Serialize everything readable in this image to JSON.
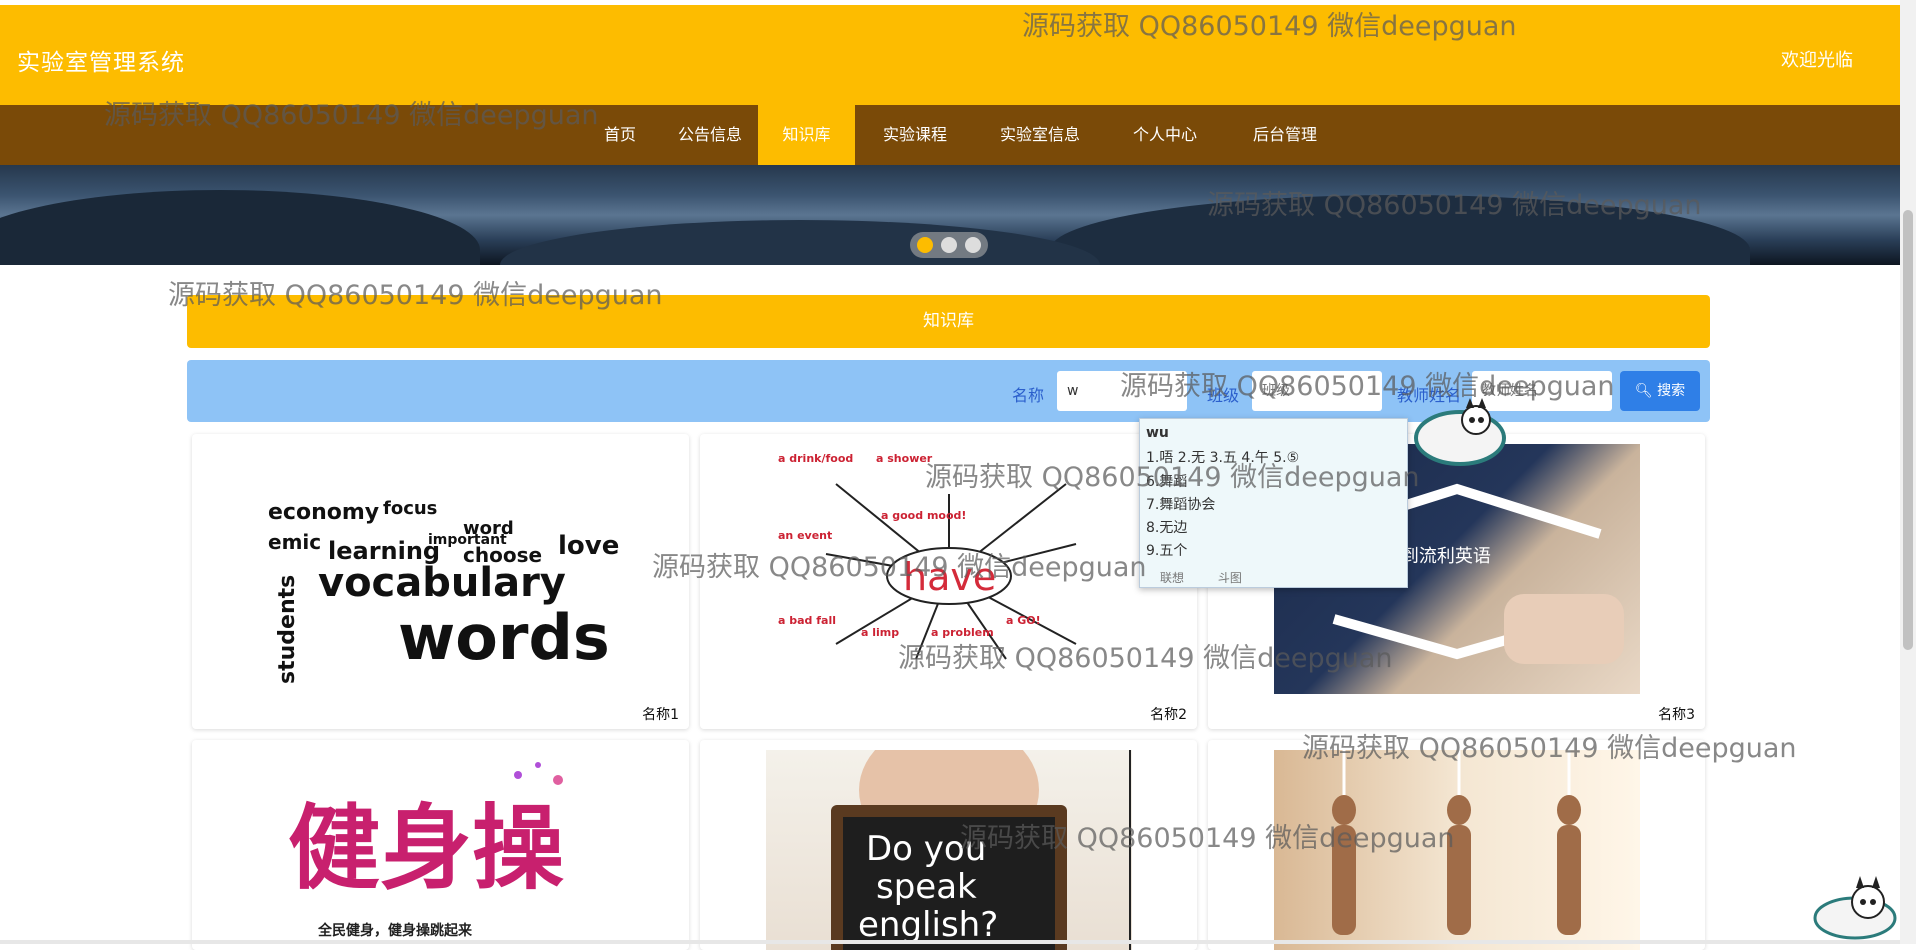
{
  "header": {
    "title": "实验室管理系统",
    "welcome": "欢迎光临"
  },
  "nav": {
    "items": [
      "首页",
      "公告信息",
      "知识库",
      "实验课程",
      "实验室信息",
      "个人中心",
      "后台管理"
    ],
    "active": "知识库"
  },
  "section": {
    "title": "知识库"
  },
  "search": {
    "name_label": "名称",
    "name_value": "w",
    "class_label": "班级",
    "class_placeholder": "班级",
    "teacher_label": "教师姓名",
    "teacher_placeholder": "教师姓名",
    "button_label": "搜索"
  },
  "cards": [
    {
      "caption": "名称1",
      "image_text": "vocabulary words"
    },
    {
      "caption": "名称2",
      "image_text": "have"
    },
    {
      "caption": "名称3",
      "image_text": "ABC到流利英语"
    },
    {
      "caption": "",
      "image_text": "健身操"
    },
    {
      "caption": "",
      "image_text": "Do you speak english?"
    },
    {
      "caption": "",
      "image_text": ""
    }
  ],
  "ime": {
    "composition": "wu",
    "candidates_row1": "1.唔  2.无  3.五  4.午  5.⑤",
    "candidates": [
      "6.舞蹈",
      "7.舞蹈协会",
      "8.无边",
      "9.五个"
    ],
    "footer": [
      "联想",
      "斗图"
    ]
  },
  "watermark": "源码获取 QQ86050149 微信deepguan",
  "colors": {
    "accent": "#fdbc00",
    "nav": "#7a4a08",
    "search_bg": "#8ec3f6",
    "button": "#2f7fe7"
  }
}
